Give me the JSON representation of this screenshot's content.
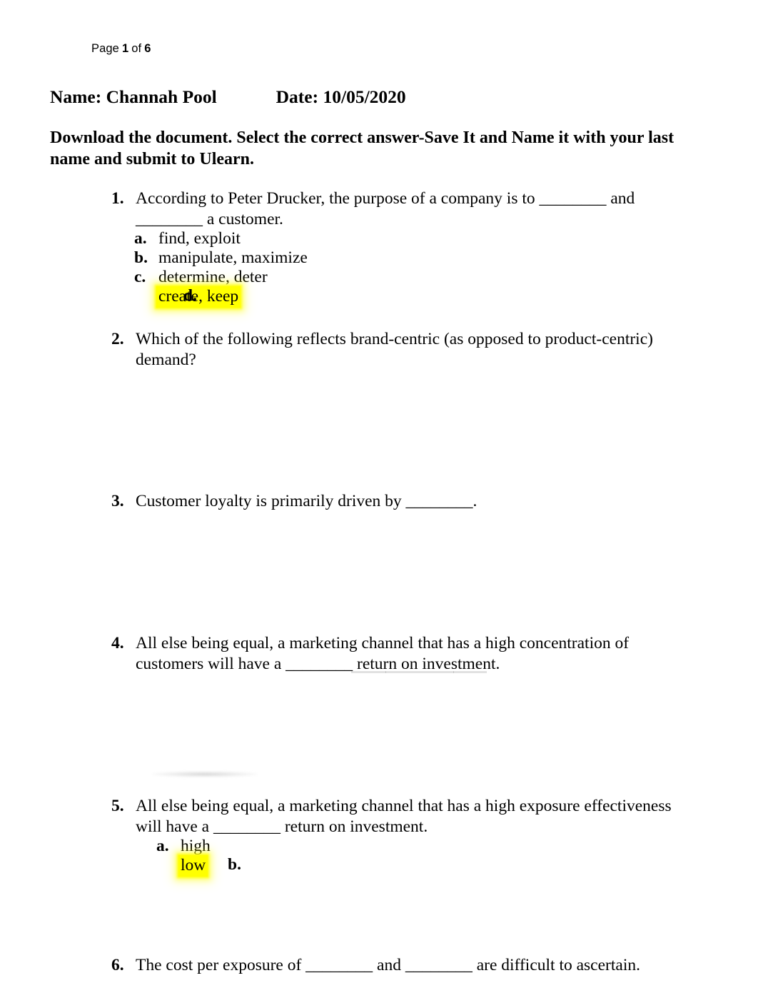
{
  "page_header": {
    "prefix": "Page",
    "current": "1",
    "middle": "of",
    "total": "6"
  },
  "identity": {
    "line": "Name: Channah Pool             Date: 10/05/2020",
    "name_label": "Name:",
    "name_value": "Channah Pool",
    "date_label": "Date:",
    "date_value": "10/05/2020"
  },
  "instructions": {
    "text": "Download the document. Select the correct answer-Save It and Name it with your last name and submit to Ulearn."
  },
  "colors": {
    "highlight": "#FFFF00",
    "text": "#000000",
    "page_background": "#FFFFFF"
  },
  "questions": [
    {
      "number": "1.",
      "text": "According to Peter Drucker, the purpose of a company is to ________ and ________ a customer.",
      "options": [
        {
          "letter": "a.",
          "text": "find, exploit",
          "highlighted": false
        },
        {
          "letter": "b.",
          "text": "manipulate, maximize",
          "highlighted": false
        },
        {
          "letter": "c.",
          "text": "determine, deter",
          "highlighted": false
        },
        {
          "letter": "d.",
          "text": "create, keep",
          "highlighted": true
        }
      ]
    },
    {
      "number": "2.",
      "text": "Which of the following reflects brand-centric (as opposed to product-centric) demand?",
      "options": []
    },
    {
      "number": "3.",
      "text": "Customer loyalty is primarily driven by ________.",
      "options": []
    },
    {
      "number": "4.",
      "text": "All else being equal, a marketing channel that has a high concentration of customers will have a ________ return on investment.",
      "options": []
    },
    {
      "number": "5.",
      "text": "All else being equal, a marketing channel that has a high exposure effectiveness will have a ________ return on investment.",
      "options": [
        {
          "letter": "a.",
          "text": "high",
          "highlighted": false
        },
        {
          "letter": "b.",
          "text": "low",
          "highlighted": true
        }
      ]
    },
    {
      "number": "6.",
      "text": "The cost per exposure of ________ and ________ are difficult to ascertain.",
      "options": []
    }
  ]
}
